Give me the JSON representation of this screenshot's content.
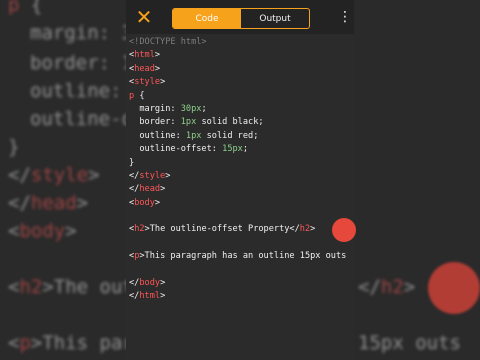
{
  "background": {
    "lines": [
      "p {",
      "  margin: 3",
      "  border: 1",
      "  outline:",
      "  outline-o",
      "}",
      "</style>",
      "</head>",
      "<body>",
      "<h2>The outl",
      "<p>This para"
    ]
  },
  "toolbar": {
    "tabs": [
      {
        "label": "Code",
        "active": true
      },
      {
        "label": "Output",
        "active": false
      }
    ]
  },
  "editor": {
    "lines": [
      "<!DOCTYPE html>",
      "<html>",
      "<head>",
      "<style>",
      "p {",
      "  margin: 30px;",
      "  border: 1px solid black;",
      "  outline: 1px solid red;",
      "  outline-offset: 15px;",
      "}",
      "</style>",
      "</head>",
      "<body>",
      "",
      "<h2>The outline-offset Property</h2>",
      "",
      "<p>This paragraph has an outline 15px outs",
      "",
      "</body>",
      "</html>"
    ]
  },
  "colors": {
    "accent": "#f7a21b",
    "tag": "#ff5656",
    "value": "#8ed08a",
    "fab": "#e6483c"
  },
  "icons": {
    "close": "close-icon",
    "more": "more-vert-icon"
  }
}
